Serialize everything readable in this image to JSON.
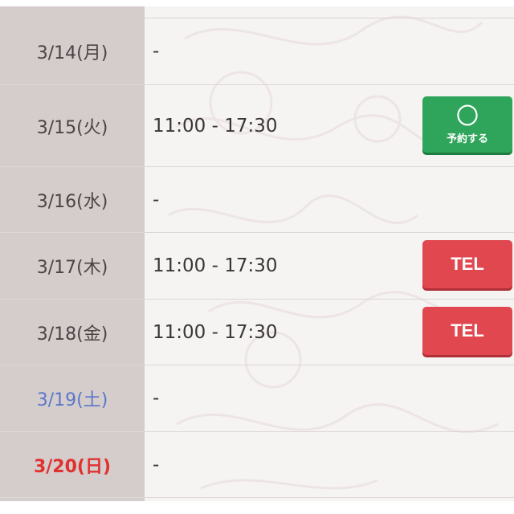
{
  "schedule": {
    "rows": [
      {
        "date": "3/14(月)",
        "hours": "-"
      },
      {
        "date": "3/15(火)",
        "hours": "11:00 - 17:30",
        "button_symbol": "〇",
        "button_label": "予約する"
      },
      {
        "date": "3/16(水)",
        "hours": "-"
      },
      {
        "date": "3/17(木)",
        "hours": "11:00 - 17:30",
        "button_label": "TEL"
      },
      {
        "date": "3/18(金)",
        "hours": "11:00 - 17:30",
        "button_label": "TEL"
      },
      {
        "date": "3/19(土)",
        "hours": "-"
      },
      {
        "date": "3/20(日)",
        "hours": "-"
      }
    ]
  },
  "colors": {
    "reserve_button": "#2ea55a",
    "tel_button": "#e0474f",
    "saturday_text": "#5a78c8",
    "sunday_text": "#e0312f",
    "date_column_bg": "#d5cccc"
  }
}
